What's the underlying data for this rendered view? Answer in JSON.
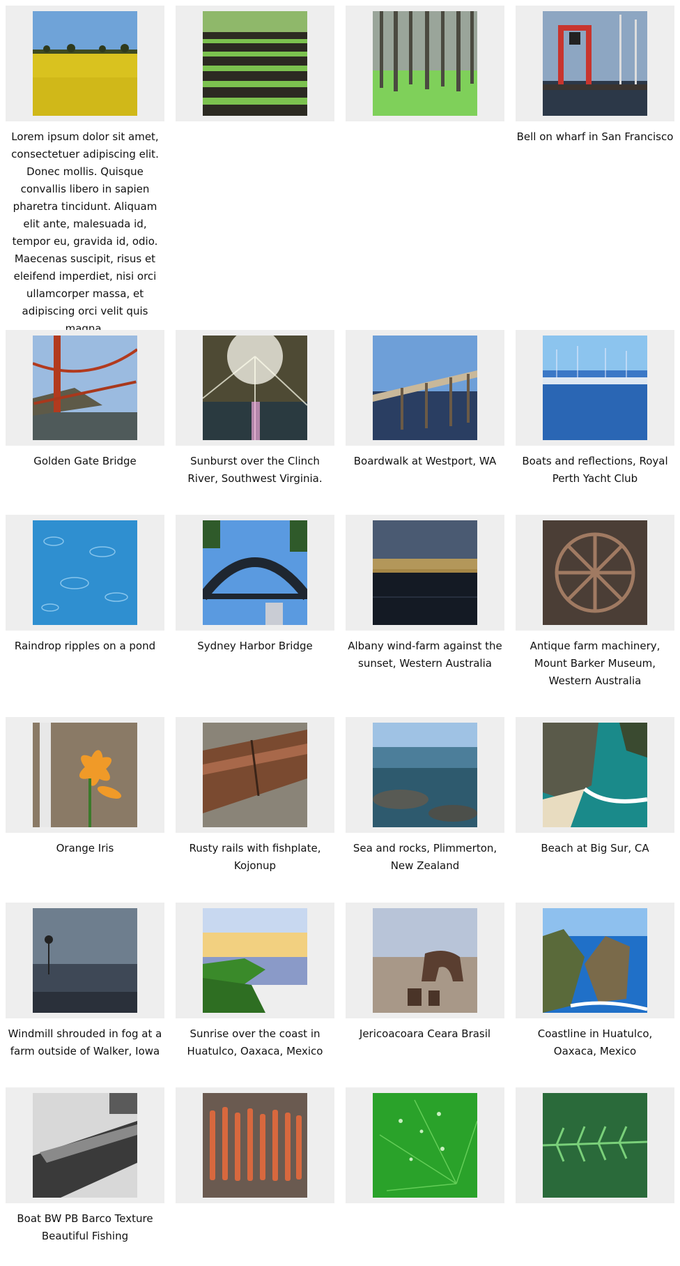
{
  "gallery": {
    "items": [
      {
        "thumb": "yellow-field",
        "caption": "Lorem ipsum dolor sit amet, consectetuer adipiscing elit. Donec mollis. Quisque convallis libero in sapien pharetra tincidunt. Aliquam elit ante, malesuada id, tempor eu, gravida id, odio. Maecenas suscipit, risus et eleifend imperdiet, nisi orci ullamcorper massa, et adipiscing orci velit quis magna."
      },
      {
        "thumb": "crop-rows",
        "caption": ""
      },
      {
        "thumb": "forest-grass",
        "caption": ""
      },
      {
        "thumb": "wharf-bell",
        "caption": "Bell on wharf in San Francisco"
      },
      {
        "thumb": "golden-gate",
        "caption": "Golden Gate Bridge"
      },
      {
        "thumb": "sunburst-river",
        "caption": "Sunburst over the Clinch River, Southwest Virginia."
      },
      {
        "thumb": "boardwalk",
        "caption": "Boardwalk at Westport, WA"
      },
      {
        "thumb": "yacht-club",
        "caption": "Boats and reflections, Royal Perth Yacht Club"
      },
      {
        "thumb": "raindrop-pond",
        "caption": "Raindrop ripples on a pond"
      },
      {
        "thumb": "harbor-bridge",
        "caption": "Sydney Harbor Bridge"
      },
      {
        "thumb": "windfarm-sunset",
        "caption": "Albany wind-farm against the sunset, Western Australia"
      },
      {
        "thumb": "farm-machinery",
        "caption": "Antique farm machinery, Mount Barker Museum, Western Australia"
      },
      {
        "thumb": "orange-iris",
        "caption": "Orange Iris"
      },
      {
        "thumb": "rusty-rails",
        "caption": "Rusty rails with fishplate, Kojonup"
      },
      {
        "thumb": "sea-rocks",
        "caption": "Sea and rocks, Plimmerton, New Zealand"
      },
      {
        "thumb": "big-sur-beach",
        "caption": "Beach at Big Sur, CA"
      },
      {
        "thumb": "foggy-windmill",
        "caption": "Windmill shrouded in fog at a farm outside of Walker, Iowa"
      },
      {
        "thumb": "coast-sunrise",
        "caption": "Sunrise over the coast in Huatulco, Oaxaca, Mexico"
      },
      {
        "thumb": "rock-arch",
        "caption": "Jericoacoara Ceara Brasil"
      },
      {
        "thumb": "huatulco-coast",
        "caption": "Coastline in Huatulco, Oaxaca, Mexico"
      },
      {
        "thumb": "bw-boat",
        "caption": "Boat BW PB Barco Texture Beautiful Fishing"
      },
      {
        "thumb": "bark-texture",
        "caption": ""
      },
      {
        "thumb": "water-drops-leaf",
        "caption": ""
      },
      {
        "thumb": "fern",
        "caption": ""
      }
    ]
  }
}
